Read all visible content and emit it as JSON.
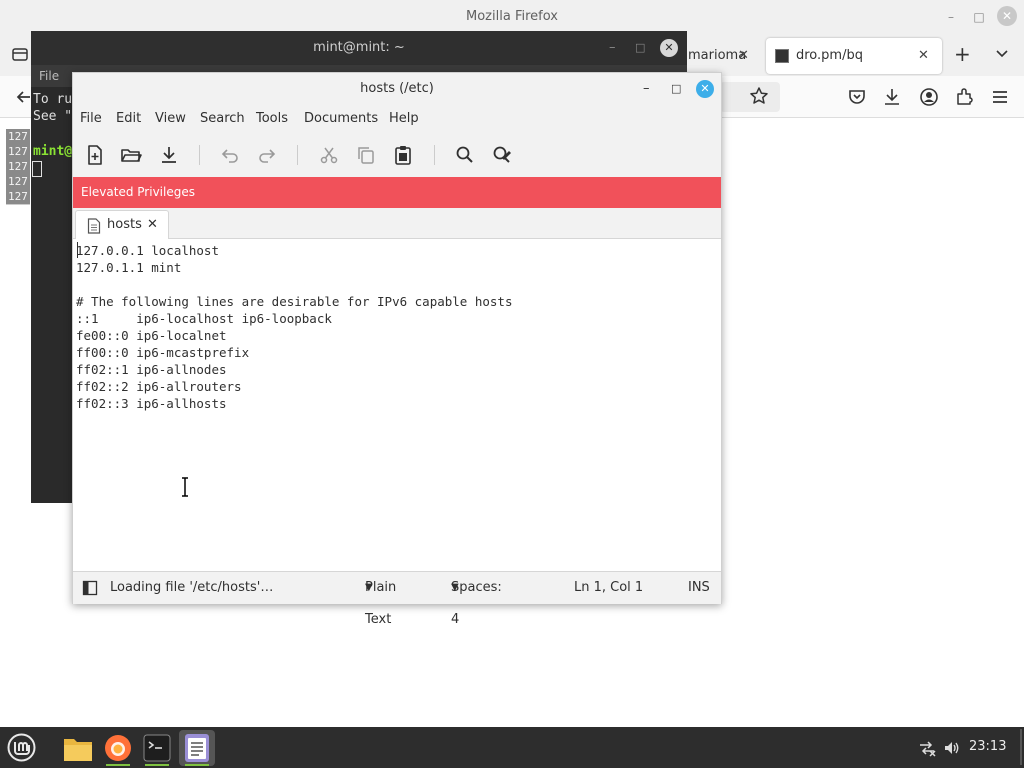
{
  "firefox": {
    "window_title": "Mozilla Firefox",
    "tabs": [
      {
        "label": "marioma"
      },
      {
        "label": "dro.pm/bq"
      }
    ]
  },
  "terminal": {
    "window_title": "mint@mint: ~",
    "menu_file": "File",
    "lines": [
      "To ru",
      "See \""
    ],
    "gutter": [
      "127",
      "127",
      "127",
      "127",
      "127"
    ],
    "prompt": "mint@"
  },
  "gedit": {
    "window_title": "hosts (/etc)",
    "menu": [
      "File",
      "Edit",
      "View",
      "Search",
      "Tools",
      "Documents",
      "Help"
    ],
    "banner": "Elevated Privileges",
    "tab_label": "hosts",
    "content": "127.0.0.1 localhost\n127.0.1.1 mint\n\n# The following lines are desirable for IPv6 capable hosts\n::1     ip6-localhost ip6-loopback\nfe00::0 ip6-localnet\nff00::0 ip6-mcastprefix\nff02::1 ip6-allnodes\nff02::2 ip6-allrouters\nff02::3 ip6-allhosts",
    "status": {
      "message": "Loading file '/etc/hosts'…",
      "language": "Plain Text",
      "spaces": "Spaces: 4",
      "position": "Ln 1, Col 1",
      "mode": "INS"
    }
  },
  "taskbar": {
    "clock": "23:13"
  },
  "colors": {
    "banner": "#f1515a",
    "close_button": "#3daee9",
    "mint_green": "#7fc241"
  }
}
